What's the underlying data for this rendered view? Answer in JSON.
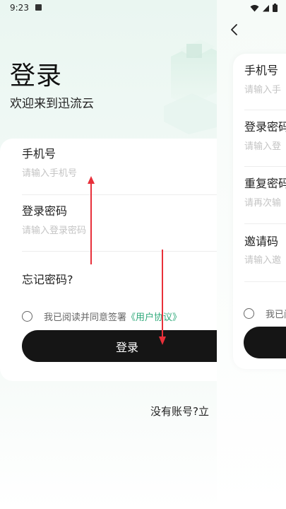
{
  "status_bar": {
    "time": "9:23"
  },
  "login": {
    "title": "登录",
    "welcome": "欢迎来到迅流云",
    "phone_label": "手机号",
    "phone_placeholder": "请输入手机号",
    "password_label": "登录密码",
    "password_placeholder": "请输入登录密码",
    "forgot_label": "忘记密码?",
    "agree_text": "我已阅读并同意签署",
    "agree_link": "《用户协议》",
    "login_button": "登录",
    "register_prompt": "没有账号?立"
  },
  "register": {
    "phone_label": "手机号",
    "phone_placeholder": "请输入手",
    "password_label": "登录密码",
    "password_placeholder": "请输入登",
    "repeat_label": "重复密码",
    "repeat_placeholder": "请再次输",
    "invite_label": "邀请码",
    "invite_placeholder": "请输入邀",
    "agree_text": "我已阅"
  },
  "icons": {
    "back": "chevron-left-icon",
    "wifi": "wifi-icon",
    "signal": "signal-icon",
    "battery": "battery-icon",
    "annotation": "red-arrow-icon"
  },
  "colors": {
    "accent": "#2fa97a",
    "button": "#151515",
    "annotation": "#e8303a"
  }
}
